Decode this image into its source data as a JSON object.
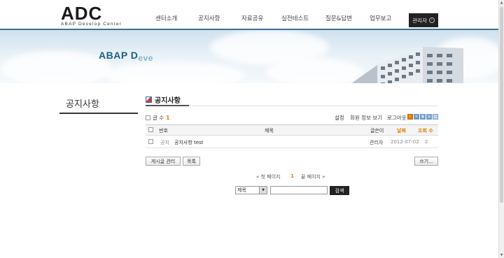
{
  "header": {
    "logo_main": "ADC",
    "logo_sub": "ABAP Develop Center",
    "nav": [
      "센터소개",
      "공지사항",
      "자료공유",
      "실전테스트",
      "질문&답변",
      "업무보고"
    ],
    "admin_label": "관리자"
  },
  "banner": {
    "title_main": "ABAP D",
    "title_fade": "eve"
  },
  "sidebar": {
    "title": "공지사항"
  },
  "board": {
    "title": "공지사항",
    "count_label": "글 수",
    "count_value": "1",
    "tools": [
      "설정",
      "회원 정보 보기",
      "로그아웃"
    ],
    "columns": {
      "num": "번호",
      "title": "제목",
      "author": "글쓴이",
      "date": "날짜",
      "views": "조회 수"
    },
    "rows": [
      {
        "num": "공지",
        "title": "공지사항 test",
        "author": "관리자",
        "date": "2012-07-02",
        "views": "2"
      }
    ],
    "buttons": {
      "manage": "게시글 관리",
      "list": "목록",
      "write": "쓰기..."
    }
  },
  "pager": {
    "first": "« 첫 페이지",
    "current": "1",
    "last": "끝 페이지 »"
  },
  "search": {
    "field": "제목",
    "value": "",
    "button": "검색"
  },
  "colors": {
    "accent": "#e07b00",
    "header_rule": "#3d6f95",
    "banner_title": "#1f5e86"
  }
}
